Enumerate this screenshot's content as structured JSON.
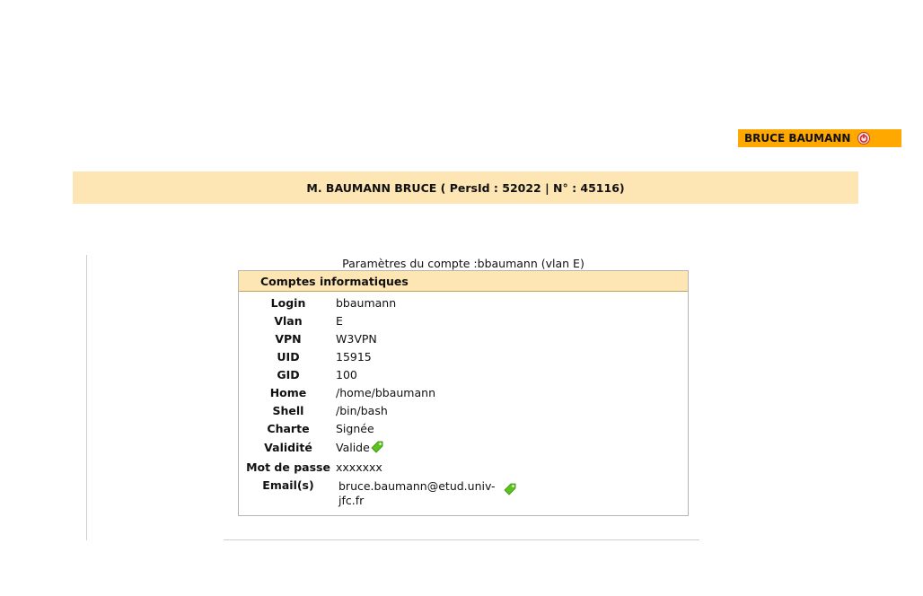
{
  "header": {
    "user_badge": "BRUCE BAUMANN",
    "identity": "M. BAUMANN BRUCE ( PersId : 52022 | N° : 45116)"
  },
  "account": {
    "caption": "Paramètres du compte :bbaumann (vlan E)",
    "box_title": "Comptes informatiques",
    "fields": [
      {
        "label": "Login",
        "value": "bbaumann"
      },
      {
        "label": "Vlan",
        "value": "E"
      },
      {
        "label": "VPN",
        "value": "W3VPN"
      },
      {
        "label": "UID",
        "value": "15915"
      },
      {
        "label": "GID",
        "value": "100"
      },
      {
        "label": "Home",
        "value": "/home/bbaumann"
      },
      {
        "label": "Shell",
        "value": "/bin/bash"
      },
      {
        "label": "Charte",
        "value": "Signée"
      },
      {
        "label": "Validité",
        "value": "Valide"
      },
      {
        "label": "Mot de passe",
        "value": "xxxxxxx"
      },
      {
        "label": "Email(s)",
        "value": "bruce.baumann@etud.univ-jfc.fr"
      }
    ]
  },
  "icons": {
    "logout": "power-icon",
    "valid_tag": "tag-icon",
    "email_tag": "tag-icon"
  },
  "colors": {
    "badge": "#ffa800",
    "header_band": "#fde6b4",
    "tag_green": "#5cc21e"
  }
}
